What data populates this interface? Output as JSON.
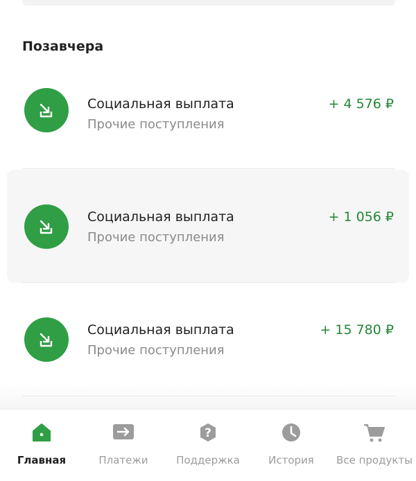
{
  "section": {
    "title": "Позавчера"
  },
  "transactions": [
    {
      "title": "Социальная выплата",
      "subtitle": "Прочие поступления",
      "amount": "+ 4 576 ₽",
      "icon": "incoming-arrow-icon"
    },
    {
      "title": "Социальная выплата",
      "subtitle": "Прочие поступления",
      "amount": "+ 1 056 ₽",
      "icon": "incoming-arrow-icon"
    },
    {
      "title": "Социальная выплата",
      "subtitle": "Прочие поступления",
      "amount": "+ 15 780 ₽",
      "icon": "incoming-arrow-icon"
    }
  ],
  "tabbar": {
    "items": [
      {
        "label": "Главная",
        "icon": "home-icon",
        "active": true
      },
      {
        "label": "Платежи",
        "icon": "transfer-icon",
        "active": false
      },
      {
        "label": "Поддержка",
        "icon": "question-icon",
        "active": false
      },
      {
        "label": "История",
        "icon": "clock-icon",
        "active": false
      },
      {
        "label": "Все продукты",
        "icon": "cart-icon",
        "active": false
      }
    ]
  },
  "colors": {
    "accent": "#2f9e44",
    "amount": "#238636",
    "inactive": "#9c9c9c"
  }
}
